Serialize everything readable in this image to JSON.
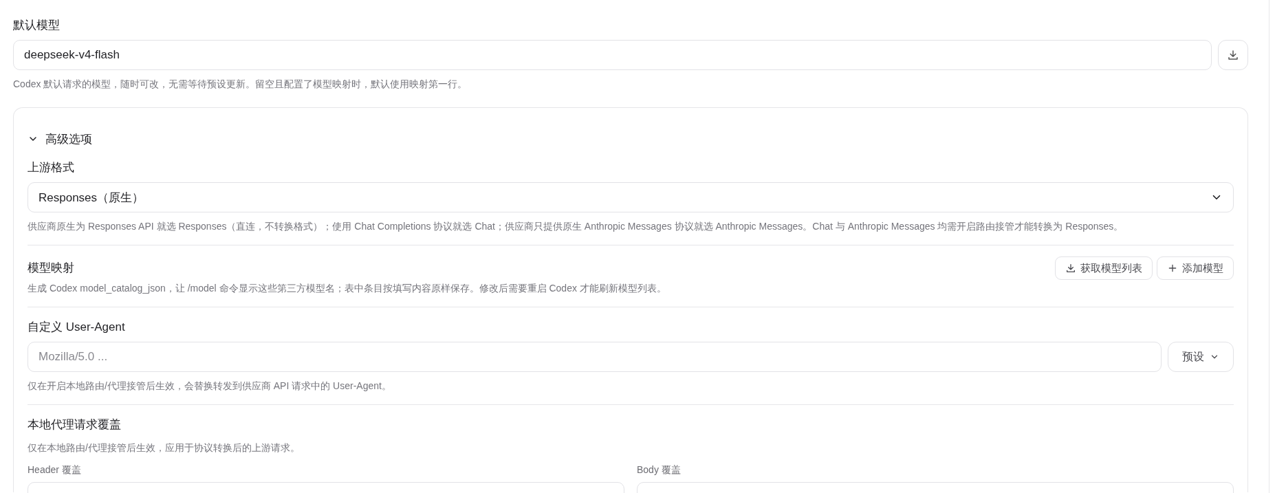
{
  "default_model": {
    "label": "默认模型",
    "value": "deepseek-v4-flash",
    "hint": "Codex 默认请求的模型，随时可改，无需等待预设更新。留空且配置了模型映射时，默认使用映射第一行。"
  },
  "advanced": {
    "title": "高级选项",
    "expanded": true,
    "sections": [
      {
        "kind": "select",
        "label": "上游格式",
        "value": "Responses（原生）",
        "hint": "供应商原生为 Responses API 就选 Responses（直连，不转换格式）；使用 Chat Completions 协议就选 Chat；供应商只提供原生 Anthropic Messages 协议就选 Anthropic Messages。Chat 与 Anthropic Messages 均需开启路由接管才能转换为 Responses。"
      },
      {
        "kind": "mapping",
        "label": "模型映射",
        "hint": "生成 Codex model_catalog_json，让 /model 命令显示这些第三方模型名；表中条目按填写内容原样保存。修改后需要重启 Codex 才能刷新模型列表。",
        "buttons": [
          "获取模型列表",
          "添加模型"
        ]
      },
      {
        "kind": "input",
        "label": "自定义 User-Agent",
        "placeholder": "Mozilla/5.0 ...",
        "preset": "预设",
        "hint": "仅在开启本地路由/代理接管后生效，会替换转发到供应商 API 请求中的 User-Agent。"
      },
      {
        "kind": "overrides",
        "label": "本地代理请求覆盖",
        "hint": "仅在本地路由/代理接管后生效，应用于协议转换后的上游请求。",
        "columns": [
          "Header 覆盖",
          "Body 覆盖"
        ]
      }
    ]
  }
}
